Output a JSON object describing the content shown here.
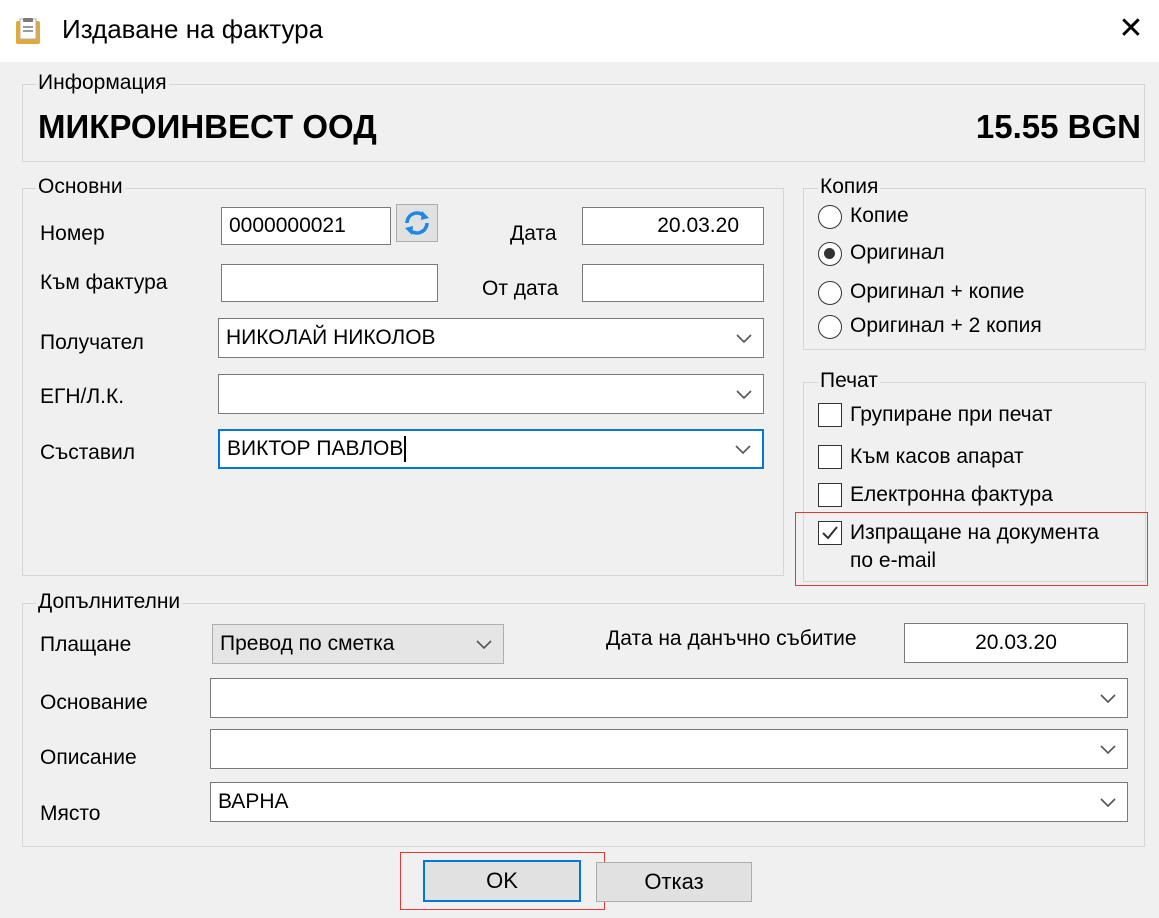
{
  "window": {
    "title": "Издаване на фактура"
  },
  "info": {
    "legend": "Информация",
    "company": "МИКРОИНВЕСТ ООД",
    "amount": "15.55 BGN"
  },
  "basic": {
    "legend": "Основни",
    "number_label": "Номер",
    "number_value": "0000000021",
    "date_label": "Дата",
    "date_value": "20.03.20",
    "to_invoice_label": "Към фактура",
    "to_invoice_value": "",
    "from_date_label": "От дата",
    "from_date_value": "",
    "recipient_label": "Получател",
    "recipient_value": "НИКОЛАЙ НИКОЛОВ",
    "egn_label": "ЕГН/Л.К.",
    "egn_value": "",
    "author_label": "Съставил",
    "author_value": "ВИКТОР ПАВЛОВ"
  },
  "copy": {
    "legend": "Копия",
    "options": [
      "Копие",
      "Оригинал",
      "Оригинал + копие",
      "Оригинал + 2 копия"
    ],
    "selected": "Оригинал"
  },
  "print": {
    "legend": "Печат",
    "options": [
      {
        "label": "Групиране при печат",
        "checked": false
      },
      {
        "label": "Към касов апарат",
        "checked": false
      },
      {
        "label": "Електронна фактура",
        "checked": false
      },
      {
        "label": "Изпращане на документа",
        "label2": "по e-mail",
        "checked": true
      }
    ]
  },
  "extra": {
    "legend": "Допълнителни",
    "payment_label": "Плащане",
    "payment_value": "Превод по сметка",
    "tax_event_label": "Дата на данъчно събитие",
    "tax_event_value": "20.03.20",
    "basis_label": "Основание",
    "basis_value": "",
    "description_label": "Описание",
    "description_value": "",
    "place_label": "Място",
    "place_value": "ВАРНА"
  },
  "buttons": {
    "ok": "OK",
    "cancel": "Отказ"
  },
  "colors": {
    "focus": "#0078d7",
    "highlight": "#e53935"
  }
}
